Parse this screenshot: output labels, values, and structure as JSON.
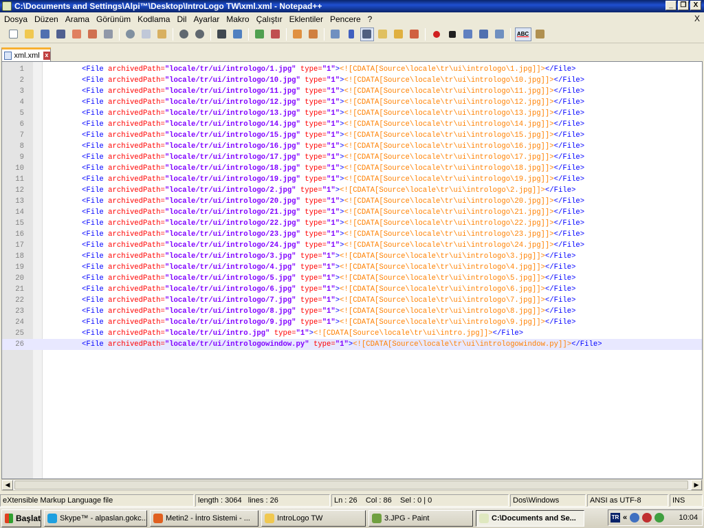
{
  "window": {
    "title": "C:\\Documents and Settings\\Alpi™\\Desktop\\IntroLogo TW\\xml.xml - Notepad++",
    "minimize": "_",
    "maximize": "❐",
    "close": "X"
  },
  "menu": {
    "items": [
      "Dosya",
      "Düzen",
      "Arama",
      "Görünüm",
      "Kodlama",
      "Dil",
      "Ayarlar",
      "Makro",
      "Çalıştır",
      "Eklentiler",
      "Pencere",
      "?"
    ],
    "close": "X"
  },
  "toolbar": {
    "icons": [
      "new-file",
      "open-file",
      "save",
      "save-all",
      "close",
      "close-all",
      "print",
      "cut",
      "copy",
      "paste",
      "undo",
      "redo",
      "find",
      "replace",
      "zoom-in",
      "zoom-out",
      "sync-vertical",
      "sync-horizontal",
      "word-wrap",
      "show-all-chars",
      "indent-guide",
      "user-defined-language",
      "doc-map",
      "function-list",
      "record-macro",
      "stop-macro",
      "play-macro",
      "run-macro-multiple",
      "save-macro",
      "spell-check",
      "plugin-tool"
    ],
    "spellcheck_label": "ABC"
  },
  "tabs": [
    {
      "label": "xml.xml",
      "close": "x"
    }
  ],
  "editor": {
    "lines": [
      {
        "num": "1",
        "tag_open": "<File ",
        "attr": "archivedPath=",
        "value": "\"locale/tr/ui/intrologo/1.jpg\"",
        "attr2": " type=",
        "value2": "\"1\"",
        "gt": ">",
        "cdata": "<![CDATA[Source\\locale\\tr\\ui\\intrologo\\1.jpg]]>",
        "tag_close": "</File>"
      },
      {
        "num": "2",
        "tag_open": "<File ",
        "attr": "archivedPath=",
        "value": "\"locale/tr/ui/intrologo/10.jpg\"",
        "attr2": " type=",
        "value2": "\"1\"",
        "gt": ">",
        "cdata": "<![CDATA[Source\\locale\\tr\\ui\\intrologo\\10.jpg]]>",
        "tag_close": "</File>"
      },
      {
        "num": "3",
        "tag_open": "<File ",
        "attr": "archivedPath=",
        "value": "\"locale/tr/ui/intrologo/11.jpg\"",
        "attr2": " type=",
        "value2": "\"1\"",
        "gt": ">",
        "cdata": "<![CDATA[Source\\locale\\tr\\ui\\intrologo\\11.jpg]]>",
        "tag_close": "</File>"
      },
      {
        "num": "4",
        "tag_open": "<File ",
        "attr": "archivedPath=",
        "value": "\"locale/tr/ui/intrologo/12.jpg\"",
        "attr2": " type=",
        "value2": "\"1\"",
        "gt": ">",
        "cdata": "<![CDATA[Source\\locale\\tr\\ui\\intrologo\\12.jpg]]>",
        "tag_close": "</File>"
      },
      {
        "num": "5",
        "tag_open": "<File ",
        "attr": "archivedPath=",
        "value": "\"locale/tr/ui/intrologo/13.jpg\"",
        "attr2": " type=",
        "value2": "\"1\"",
        "gt": ">",
        "cdata": "<![CDATA[Source\\locale\\tr\\ui\\intrologo\\13.jpg]]>",
        "tag_close": "</File>"
      },
      {
        "num": "6",
        "tag_open": "<File ",
        "attr": "archivedPath=",
        "value": "\"locale/tr/ui/intrologo/14.jpg\"",
        "attr2": " type=",
        "value2": "\"1\"",
        "gt": ">",
        "cdata": "<![CDATA[Source\\locale\\tr\\ui\\intrologo\\14.jpg]]>",
        "tag_close": "</File>"
      },
      {
        "num": "7",
        "tag_open": "<File ",
        "attr": "archivedPath=",
        "value": "\"locale/tr/ui/intrologo/15.jpg\"",
        "attr2": " type=",
        "value2": "\"1\"",
        "gt": ">",
        "cdata": "<![CDATA[Source\\locale\\tr\\ui\\intrologo\\15.jpg]]>",
        "tag_close": "</File>"
      },
      {
        "num": "8",
        "tag_open": "<File ",
        "attr": "archivedPath=",
        "value": "\"locale/tr/ui/intrologo/16.jpg\"",
        "attr2": " type=",
        "value2": "\"1\"",
        "gt": ">",
        "cdata": "<![CDATA[Source\\locale\\tr\\ui\\intrologo\\16.jpg]]>",
        "tag_close": "</File>"
      },
      {
        "num": "9",
        "tag_open": "<File ",
        "attr": "archivedPath=",
        "value": "\"locale/tr/ui/intrologo/17.jpg\"",
        "attr2": " type=",
        "value2": "\"1\"",
        "gt": ">",
        "cdata": "<![CDATA[Source\\locale\\tr\\ui\\intrologo\\17.jpg]]>",
        "tag_close": "</File>"
      },
      {
        "num": "10",
        "tag_open": "<File ",
        "attr": "archivedPath=",
        "value": "\"locale/tr/ui/intrologo/18.jpg\"",
        "attr2": " type=",
        "value2": "\"1\"",
        "gt": ">",
        "cdata": "<![CDATA[Source\\locale\\tr\\ui\\intrologo\\18.jpg]]>",
        "tag_close": "</File>"
      },
      {
        "num": "11",
        "tag_open": "<File ",
        "attr": "archivedPath=",
        "value": "\"locale/tr/ui/intrologo/19.jpg\"",
        "attr2": " type=",
        "value2": "\"1\"",
        "gt": ">",
        "cdata": "<![CDATA[Source\\locale\\tr\\ui\\intrologo\\19.jpg]]>",
        "tag_close": "</File>"
      },
      {
        "num": "12",
        "tag_open": "<File ",
        "attr": "archivedPath=",
        "value": "\"locale/tr/ui/intrologo/2.jpg\"",
        "attr2": " type=",
        "value2": "\"1\"",
        "gt": ">",
        "cdata": "<![CDATA[Source\\locale\\tr\\ui\\intrologo\\2.jpg]]>",
        "tag_close": "</File>"
      },
      {
        "num": "13",
        "tag_open": "<File ",
        "attr": "archivedPath=",
        "value": "\"locale/tr/ui/intrologo/20.jpg\"",
        "attr2": " type=",
        "value2": "\"1\"",
        "gt": ">",
        "cdata": "<![CDATA[Source\\locale\\tr\\ui\\intrologo\\20.jpg]]>",
        "tag_close": "</File>"
      },
      {
        "num": "14",
        "tag_open": "<File ",
        "attr": "archivedPath=",
        "value": "\"locale/tr/ui/intrologo/21.jpg\"",
        "attr2": " type=",
        "value2": "\"1\"",
        "gt": ">",
        "cdata": "<![CDATA[Source\\locale\\tr\\ui\\intrologo\\21.jpg]]>",
        "tag_close": "</File>"
      },
      {
        "num": "15",
        "tag_open": "<File ",
        "attr": "archivedPath=",
        "value": "\"locale/tr/ui/intrologo/22.jpg\"",
        "attr2": " type=",
        "value2": "\"1\"",
        "gt": ">",
        "cdata": "<![CDATA[Source\\locale\\tr\\ui\\intrologo\\22.jpg]]>",
        "tag_close": "</File>"
      },
      {
        "num": "16",
        "tag_open": "<File ",
        "attr": "archivedPath=",
        "value": "\"locale/tr/ui/intrologo/23.jpg\"",
        "attr2": " type=",
        "value2": "\"1\"",
        "gt": ">",
        "cdata": "<![CDATA[Source\\locale\\tr\\ui\\intrologo\\23.jpg]]>",
        "tag_close": "</File>"
      },
      {
        "num": "17",
        "tag_open": "<File ",
        "attr": "archivedPath=",
        "value": "\"locale/tr/ui/intrologo/24.jpg\"",
        "attr2": " type=",
        "value2": "\"1\"",
        "gt": ">",
        "cdata": "<![CDATA[Source\\locale\\tr\\ui\\intrologo\\24.jpg]]>",
        "tag_close": "</File>"
      },
      {
        "num": "18",
        "tag_open": "<File ",
        "attr": "archivedPath=",
        "value": "\"locale/tr/ui/intrologo/3.jpg\"",
        "attr2": " type=",
        "value2": "\"1\"",
        "gt": ">",
        "cdata": "<![CDATA[Source\\locale\\tr\\ui\\intrologo\\3.jpg]]>",
        "tag_close": "</File>"
      },
      {
        "num": "19",
        "tag_open": "<File ",
        "attr": "archivedPath=",
        "value": "\"locale/tr/ui/intrologo/4.jpg\"",
        "attr2": " type=",
        "value2": "\"1\"",
        "gt": ">",
        "cdata": "<![CDATA[Source\\locale\\tr\\ui\\intrologo\\4.jpg]]>",
        "tag_close": "</File>"
      },
      {
        "num": "20",
        "tag_open": "<File ",
        "attr": "archivedPath=",
        "value": "\"locale/tr/ui/intrologo/5.jpg\"",
        "attr2": " type=",
        "value2": "\"1\"",
        "gt": ">",
        "cdata": "<![CDATA[Source\\locale\\tr\\ui\\intrologo\\5.jpg]]>",
        "tag_close": "</File>"
      },
      {
        "num": "21",
        "tag_open": "<File ",
        "attr": "archivedPath=",
        "value": "\"locale/tr/ui/intrologo/6.jpg\"",
        "attr2": " type=",
        "value2": "\"1\"",
        "gt": ">",
        "cdata": "<![CDATA[Source\\locale\\tr\\ui\\intrologo\\6.jpg]]>",
        "tag_close": "</File>"
      },
      {
        "num": "22",
        "tag_open": "<File ",
        "attr": "archivedPath=",
        "value": "\"locale/tr/ui/intrologo/7.jpg\"",
        "attr2": " type=",
        "value2": "\"1\"",
        "gt": ">",
        "cdata": "<![CDATA[Source\\locale\\tr\\ui\\intrologo\\7.jpg]]>",
        "tag_close": "</File>"
      },
      {
        "num": "23",
        "tag_open": "<File ",
        "attr": "archivedPath=",
        "value": "\"locale/tr/ui/intrologo/8.jpg\"",
        "attr2": " type=",
        "value2": "\"1\"",
        "gt": ">",
        "cdata": "<![CDATA[Source\\locale\\tr\\ui\\intrologo\\8.jpg]]>",
        "tag_close": "</File>"
      },
      {
        "num": "24",
        "tag_open": "<File ",
        "attr": "archivedPath=",
        "value": "\"locale/tr/ui/intrologo/9.jpg\"",
        "attr2": " type=",
        "value2": "\"1\"",
        "gt": ">",
        "cdata": "<![CDATA[Source\\locale\\tr\\ui\\intrologo\\9.jpg]]>",
        "tag_close": "</File>"
      },
      {
        "num": "25",
        "tag_open": "<File ",
        "attr": "archivedPath=",
        "value": "\"locale/tr/ui/intro.jpg\"",
        "attr2": " type=",
        "value2": "\"1\"",
        "gt": ">",
        "cdata": "<![CDATA[Source\\locale\\tr\\ui\\intro.jpg]]>",
        "tag_close": "</File>"
      },
      {
        "num": "26",
        "tag_open": "<File ",
        "attr": "archivedPath=",
        "value": "\"locale/tr/ui/intrologowindow.py\"",
        "attr2": " type=",
        "value2": "\"1\"",
        "gt": ">",
        "cdata": "<![CDATA[Source\\locale\\tr\\ui\\intrologowindow.py]]>",
        "tag_close": "</File>"
      }
    ],
    "current_line": 26
  },
  "statusbar": {
    "filetype": "eXtensible Markup Language file",
    "length": "length : 3064",
    "lines": "lines : 26",
    "position": "Ln : 26    Col : 86    Sel : 0 | 0",
    "eol": "Dos\\Windows",
    "encoding": "ANSI as UTF-8",
    "mode": "INS"
  },
  "taskbar": {
    "start": "Başlat",
    "items": [
      {
        "label": "Skype™ - alpaslan.gokc...",
        "icon_color": "#1ea0e0",
        "active": false
      },
      {
        "label": "Metin2 - İntro Sistemi - ...",
        "icon_color": "#e06020",
        "active": false
      },
      {
        "label": "IntroLogo TW",
        "icon_color": "#f0c850",
        "active": false
      },
      {
        "label": "3.JPG - Paint",
        "icon_color": "#70a040",
        "active": false
      },
      {
        "label": "C:\\Documents and Se...",
        "icon_color": "#dfe8c0",
        "active": true
      }
    ],
    "tray": {
      "lang": "TR",
      "chevron": "«",
      "clock": "10:04"
    }
  },
  "colors": {
    "tag": "#0000ff",
    "attribute": "#ff0000",
    "value": "#8000ff",
    "cdata": "#ff8000",
    "current_line": "#e8e8ff",
    "title_bar": "#0a246a"
  }
}
